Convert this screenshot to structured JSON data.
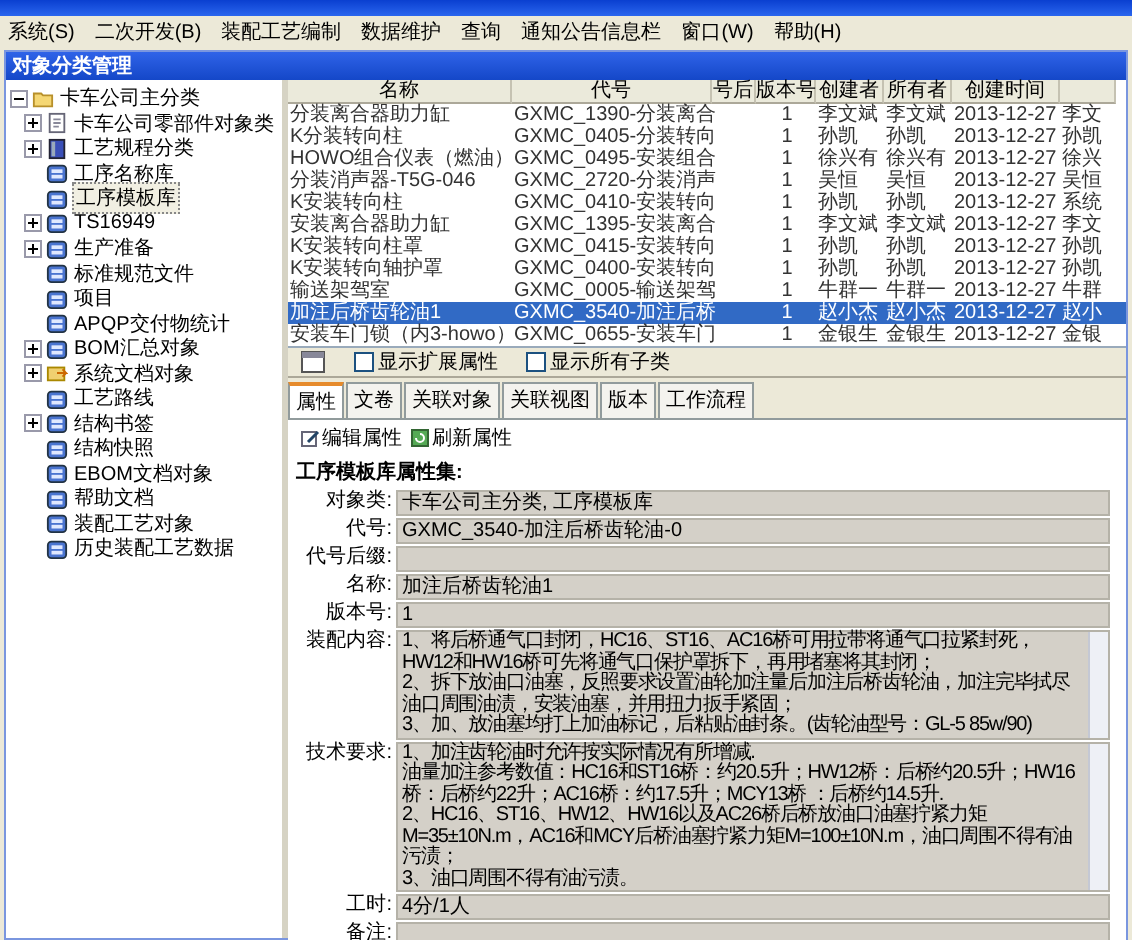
{
  "menu": [
    "系统(S)",
    "二次开发(B)",
    "装配工艺编制",
    "数据维护",
    "查询",
    "通知公告信息栏",
    "窗口(W)",
    "帮助(H)"
  ],
  "panel_title": "对象分类管理",
  "tree": {
    "label": "卡车公司主分类",
    "expanded": true,
    "children": [
      {
        "label": "卡车公司零部件对象类",
        "kind": "part",
        "collapsible": true,
        "selected": false
      },
      {
        "label": "工艺规程分类",
        "kind": "process",
        "collapsible": true,
        "selected": false
      },
      {
        "label": "工序名称库",
        "kind": "library",
        "collapsible": false,
        "selected": false
      },
      {
        "label": "工序模板库",
        "kind": "library",
        "collapsible": false,
        "selected": true
      },
      {
        "label": "TS16949",
        "kind": "library",
        "collapsible": true,
        "selected": false
      },
      {
        "label": "生产准备",
        "kind": "library",
        "collapsible": true,
        "selected": false
      },
      {
        "label": "标准规范文件",
        "kind": "library",
        "collapsible": false,
        "selected": false
      },
      {
        "label": "项目",
        "kind": "library",
        "collapsible": false,
        "selected": false
      },
      {
        "label": "APQP交付物统计",
        "kind": "library",
        "collapsible": false,
        "selected": false
      },
      {
        "label": "BOM汇总对象",
        "kind": "library",
        "collapsible": true,
        "selected": false
      },
      {
        "label": "系统文档对象",
        "kind": "system",
        "collapsible": true,
        "selected": false
      },
      {
        "label": "工艺路线",
        "kind": "library",
        "collapsible": false,
        "selected": false
      },
      {
        "label": "结构书签",
        "kind": "library",
        "collapsible": true,
        "selected": false
      },
      {
        "label": "结构快照",
        "kind": "library",
        "collapsible": false,
        "selected": false
      },
      {
        "label": "EBOM文档对象",
        "kind": "library",
        "collapsible": false,
        "selected": false
      },
      {
        "label": "帮助文档",
        "kind": "library",
        "collapsible": false,
        "selected": false
      },
      {
        "label": "装配工艺对象",
        "kind": "library",
        "collapsible": false,
        "selected": false
      },
      {
        "label": "历史装配工艺数据",
        "kind": "library",
        "collapsible": false,
        "selected": false
      }
    ]
  },
  "table": {
    "columns": [
      "名称",
      "代号",
      "号后",
      "版本号",
      "创建者",
      "所有者",
      "创建时间"
    ],
    "rows": [
      {
        "cells": [
          "分装离合器助力缸",
          "GXMC_1390-分装离合",
          "",
          "1",
          "李文斌",
          "李文斌",
          "2013-12-27",
          "李文"
        ],
        "selected": false
      },
      {
        "cells": [
          "K分装转向柱",
          "GXMC_0405-分装转向",
          "",
          "1",
          "孙凯",
          "孙凯",
          "2013-12-27",
          "孙凯"
        ],
        "selected": false
      },
      {
        "cells": [
          "HOWO组合仪表（燃油）",
          "GXMC_0495-安装组合",
          "",
          "1",
          "徐兴有",
          "徐兴有",
          "2013-12-27",
          "徐兴"
        ],
        "selected": false
      },
      {
        "cells": [
          "分装消声器-T5G-046",
          "GXMC_2720-分装消声",
          "",
          "1",
          "吴恒",
          "吴恒",
          "2013-12-27",
          "吴恒"
        ],
        "selected": false
      },
      {
        "cells": [
          "K安装转向柱",
          "GXMC_0410-安装转向",
          "",
          "1",
          "孙凯",
          "孙凯",
          "2013-12-27",
          "系统"
        ],
        "selected": false
      },
      {
        "cells": [
          "安装离合器助力缸",
          "GXMC_1395-安装离合",
          "",
          "1",
          "李文斌",
          "李文斌",
          "2013-12-27",
          "李文"
        ],
        "selected": false
      },
      {
        "cells": [
          "K安装转向柱罩",
          "GXMC_0415-安装转向",
          "",
          "1",
          "孙凯",
          "孙凯",
          "2013-12-27",
          "孙凯"
        ],
        "selected": false
      },
      {
        "cells": [
          "K安装转向轴护罩",
          "GXMC_0400-安装转向",
          "",
          "1",
          "孙凯",
          "孙凯",
          "2013-12-27",
          "孙凯"
        ],
        "selected": false
      },
      {
        "cells": [
          "输送架驾室",
          "GXMC_0005-输送架驾",
          "",
          "1",
          "牛群一",
          "牛群一",
          "2013-12-27",
          "牛群"
        ],
        "selected": false
      },
      {
        "cells": [
          "加注后桥齿轮油1",
          "GXMC_3540-加注后桥",
          "",
          "1",
          "赵小杰",
          "赵小杰",
          "2013-12-27",
          "赵小"
        ],
        "selected": true
      },
      {
        "cells": [
          "安装车门锁（内3-howo）",
          "GXMC_0655-安装车门",
          "",
          "1",
          "金银生",
          "金银生",
          "2013-12-27",
          "金银"
        ],
        "selected": false
      }
    ]
  },
  "options": [
    {
      "label": "显示扩展属性",
      "checked": false
    },
    {
      "label": "显示所有子类",
      "checked": false
    }
  ],
  "tabs": [
    {
      "label": "属性",
      "selected": true
    },
    {
      "label": "文卷",
      "selected": false
    },
    {
      "label": "关联对象",
      "selected": false
    },
    {
      "label": "关联视图",
      "selected": false
    },
    {
      "label": "版本",
      "selected": false
    },
    {
      "label": "工作流程",
      "selected": false
    }
  ],
  "actions": [
    "编辑属性",
    "刷新属性"
  ],
  "section_title": "工序模板库属性集:",
  "fields": [
    {
      "label": "对象类:",
      "kind": "line",
      "value": "卡车公司主分类, 工序模板库"
    },
    {
      "label": "代号:",
      "kind": "line",
      "value": "GXMC_3540-加注后桥齿轮油-0"
    },
    {
      "label": "代号后缀:",
      "kind": "line"
    },
    {
      "label": "名称:",
      "kind": "line",
      "value": "加注后桥齿轮油1"
    },
    {
      "label": "版本号:",
      "kind": "line",
      "value": "1"
    },
    {
      "label": "装配内容:",
      "kind": "text",
      "value": "1、将后桥通气口封闭，HC16、ST16、AC16桥可用拉带将通气口拉紧封死，HW12和HW16桥可先将通气口保护罩拆下，再用堵塞将其封闭；\n2、拆下放油口油塞，反照要求设置油轮加注量后加注后桥齿轮油，加注完毕拭尽油口周围油渍，安装油塞，并用扭力扳手紧固；\n3、加、放油塞均打上加油标记，后粘贴油封条。(齿轮油型号：GL-5 85w/90)"
    },
    {
      "label": "技术要求:",
      "kind": "text",
      "value": "1、加注齿轮油时允许按实际情况有所增减.\n油量加注参考数值：HC16和ST16桥：约20.5升；HW12桥：后桥约20.5升；HW16桥：后桥约22升；AC16桥：约17.5升；MCY13桥 ：后桥约14.5升.\n2、HC16、ST16、HW12、HW16以及AC26桥后桥放油口油塞拧紧力矩M=35±10N.m，AC16和MCY后桥油塞拧紧力矩M=100±10N.m，油口周围不得有油污渍；\n3、油口周围不得有油污渍。"
    },
    {
      "label": "工时:",
      "kind": "line",
      "value": "4分/1人"
    },
    {
      "label": "备注:",
      "kind": "line"
    }
  ]
}
